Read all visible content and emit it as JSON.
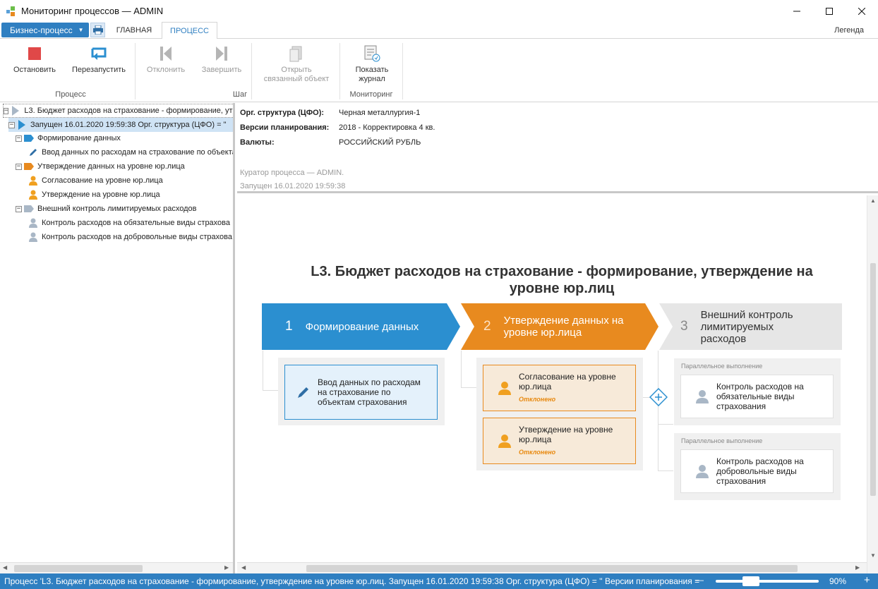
{
  "window": {
    "title": "Мониторинг процессов — ADMIN"
  },
  "ribbon": {
    "app_menu_label": "Бизнес-процесс",
    "tabs": [
      {
        "label": "ГЛАВНАЯ",
        "active": false
      },
      {
        "label": "ПРОЦЕСС",
        "active": true
      }
    ],
    "legend_label": "Легенда",
    "buttons": {
      "stop": "Остановить",
      "restart": "Перезапустить",
      "reject": "Отклонить",
      "finish": "Завершить",
      "open_related_1": "Открыть",
      "open_related_2": "связанный объект",
      "show_log_1": "Показать",
      "show_log_2": "журнал"
    },
    "groups": {
      "process": "Процесс",
      "step": "Шаг",
      "monitoring": "Мониторинг"
    }
  },
  "tree": {
    "root": "L3. Бюджет расходов на страхование - формирование, утв",
    "launch": "Запущен 16.01.2020 19:59:38 Орг. структура (ЦФО) = \"",
    "stage1": "Формирование данных",
    "stage1_task1": "Ввод данных по расходам на страхование по объекта",
    "stage2": "Утверждение данных на уровне юр.лица",
    "stage2_task1": "Согласование на уровне юр.лица",
    "stage2_task2": "Утверждение на уровне юр.лица",
    "stage3": "Внешний контроль лимитируемых расходов",
    "stage3_task1": "Контроль расходов на обязательные виды страхова",
    "stage3_task2": "Контроль расходов на добровольные виды страхова"
  },
  "info": {
    "org_key": "Орг. структура (ЦФО):",
    "org_val": "Черная металлургия-1",
    "plan_key": "Версии планирования:",
    "plan_val": "2018 - Корректировка 4 кв.",
    "cur_key": "Валюты:",
    "cur_val": "РОССИЙСКИЙ РУБЛЬ",
    "curator": "Куратор процесса — ADMIN.",
    "started": "Запущен 16.01.2020 19:59:38"
  },
  "diagram": {
    "title_line1": "L3. Бюджет расходов на страхование - формирование, утверждение на",
    "title_line2": "уровне юр.лиц",
    "stages": [
      {
        "num": "1",
        "label": "Формирование данных",
        "color": "#2b8fd0"
      },
      {
        "num": "2",
        "label_1": "Утверждение данных на",
        "label_2": "уровне юр.лица",
        "color": "#e88a1f"
      },
      {
        "num": "3",
        "label_1": "Внешний контроль",
        "label_2": "лимитируемых",
        "label_3": "расходов",
        "color": "#e6e6e6"
      }
    ],
    "task1": {
      "l1": "Ввод данных по расходам",
      "l2": "на страхование по",
      "l3": "объектам страхования"
    },
    "task2": {
      "l1": "Согласование на уровне",
      "l2": "юр.лица",
      "status": "Отклонено"
    },
    "task3": {
      "l1": "Утверждение на уровне",
      "l2": "юр.лица",
      "status": "Отклонено"
    },
    "parallel_label": "Параллельное выполнение",
    "task4": {
      "l1": "Контроль расходов на",
      "l2": "обязательные виды",
      "l3": "страхования"
    },
    "task5": {
      "l1": "Контроль расходов на",
      "l2": "добровольные виды",
      "l3": "страхования"
    }
  },
  "statusbar": {
    "text": "Процесс 'L3. Бюджет расходов на страхование - формирование, утверждение на уровне юр.лиц. Запущен 16.01.2020 19:59:38 Орг. структура (ЦФО) = ''  Версии планирования =",
    "zoom": "90%",
    "zoom_level_percent": 90
  },
  "colors": {
    "accent": "#2f7fc1",
    "stage_blue": "#2b8fd0",
    "stage_orange": "#e88a1f",
    "stage_gray": "#e6e6e6",
    "stop_red": "#e04848",
    "person_orange": "#f0a020",
    "person_gray": "#a9b7c6"
  }
}
